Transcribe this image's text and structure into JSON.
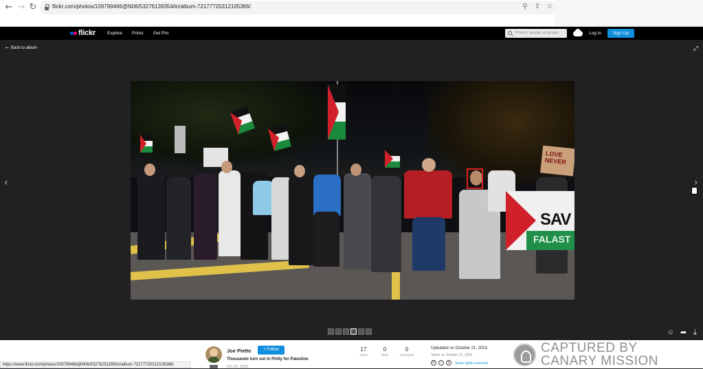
{
  "browser": {
    "url": "flickr.com/photos/109799466@N06/53276139354/in/album-72177720312105366/",
    "status_url": "https://www.flickr.com/photos/109799466@N06/53276251395/in/album-72177720312105366/"
  },
  "header": {
    "logo": "flickr",
    "nav": [
      "Explore",
      "Prints",
      "Get Pro"
    ],
    "search_placeholder": "Photos, people, or groups",
    "login": "Log In",
    "signup": "Sign Up"
  },
  "lightbox": {
    "back_label": "Back to album",
    "photo": {
      "sign_text": "LOVE NEVER",
      "banner_text": "SAV",
      "banner_text2": "FALAST"
    }
  },
  "info": {
    "owner": "Joe Piette",
    "follow": "+ Follow",
    "title": "Thousands turn out in Philly for Palestine",
    "date": "Oct 21, 2023",
    "stats": [
      {
        "value": "17",
        "label": "views"
      },
      {
        "value": "0",
        "label": "faves"
      },
      {
        "value": "0",
        "label": "comments"
      }
    ],
    "uploaded": "Uploaded on October 21, 2023",
    "taken": "Taken on October 21, 2023",
    "rights": "Some rights reserved"
  },
  "watermark": {
    "line1": "CAPTURED BY",
    "line2": "CANARY MISSION"
  },
  "colors": {
    "accent": "#128fdc",
    "background": "#212124"
  }
}
